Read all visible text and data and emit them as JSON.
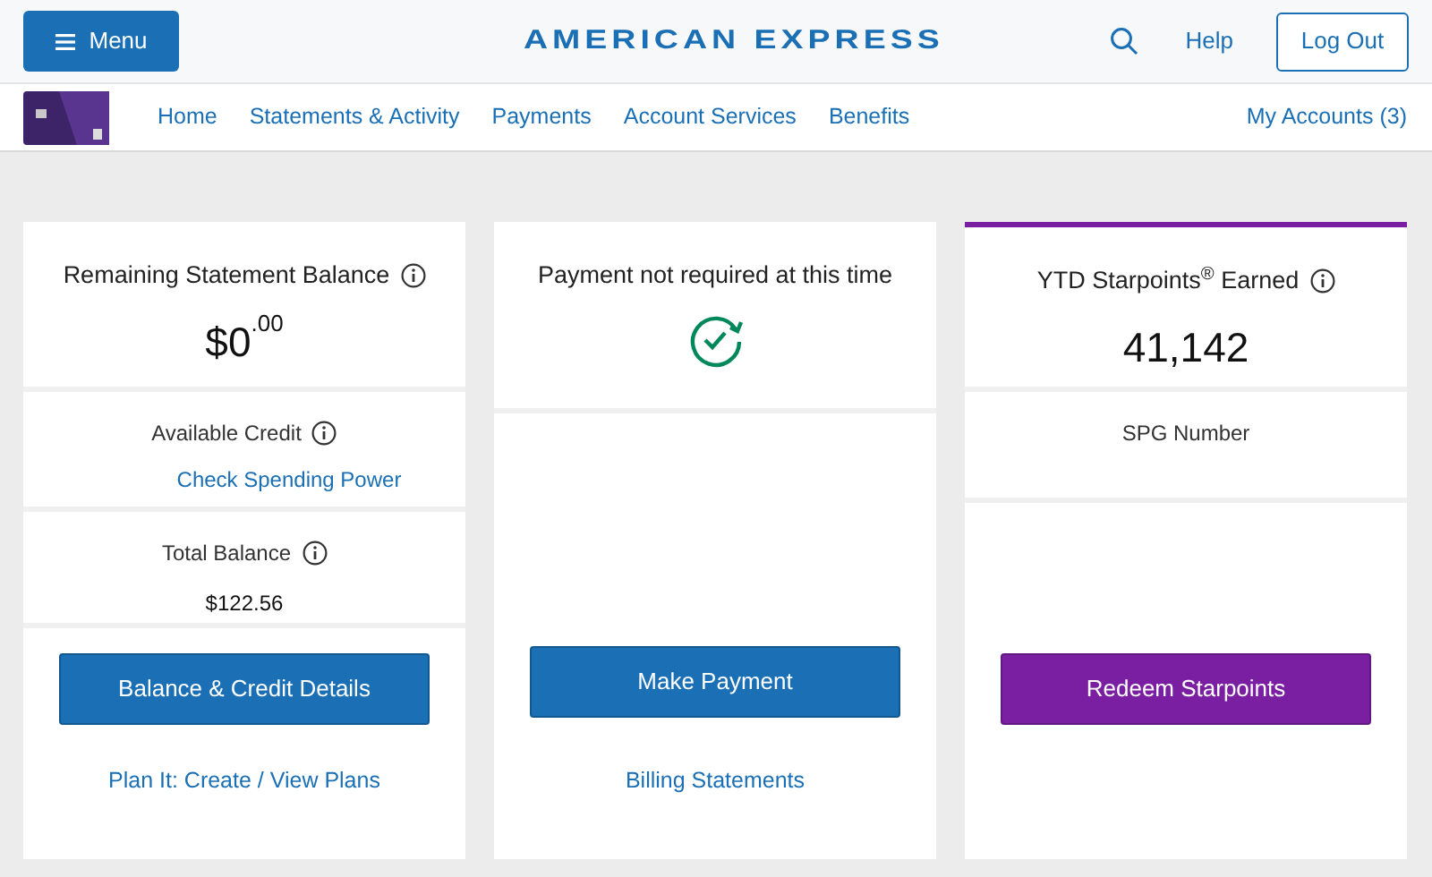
{
  "header": {
    "menu_button": "Menu",
    "logo": "AMERICAN EXPRESS",
    "help": "Help",
    "logout": "Log Out"
  },
  "nav": {
    "items": [
      "Home",
      "Statements & Activity",
      "Payments",
      "Account Services",
      "Benefits"
    ],
    "my_accounts": "My Accounts (3)"
  },
  "cards": [
    {
      "top_bar": false,
      "sections": [
        [
          {
            "kind": "heading",
            "text": "Remaining Statement Balance",
            "info": true
          },
          {
            "kind": "amount",
            "text": "$0$^{.00}$"
          }
        ],
        [
          {
            "kind": "label",
            "text": "Available Credit",
            "info": true
          },
          {
            "kind": "link",
            "text": "Check Spending Power"
          }
        ],
        [
          {
            "kind": "label",
            "text": "Total Balance",
            "info": true
          },
          {
            "kind": "value",
            "text": "$122.56"
          }
        ]
      ],
      "button": {
        "label": "Balance & Credit Details",
        "color": "#1a6fb5"
      },
      "link": "Plan It: Create / View Plans"
    },
    {
      "top_bar": false,
      "sections": [
        [
          {
            "kind": "heading",
            "text": "Payment not required at this time",
            "info": false
          },
          {
            "kind": "status_icon"
          }
        ]
      ],
      "button": {
        "label": "Make Payment",
        "color": "#1a6fb5"
      },
      "link": "Billing Statements"
    },
    {
      "top_bar": true,
      "sections": [
        [
          {
            "kind": "heading",
            "text": "YTD Starpoints$^{®}$ Earned",
            "info": true
          },
          {
            "kind": "big_number",
            "text": "41,142"
          }
        ],
        [
          {
            "kind": "label",
            "text": "SPG Number",
            "info": false
          }
        ]
      ],
      "button": {
        "label": "Redeem Starpoints",
        "color": "#7b1fa2"
      }
    }
  ]
}
